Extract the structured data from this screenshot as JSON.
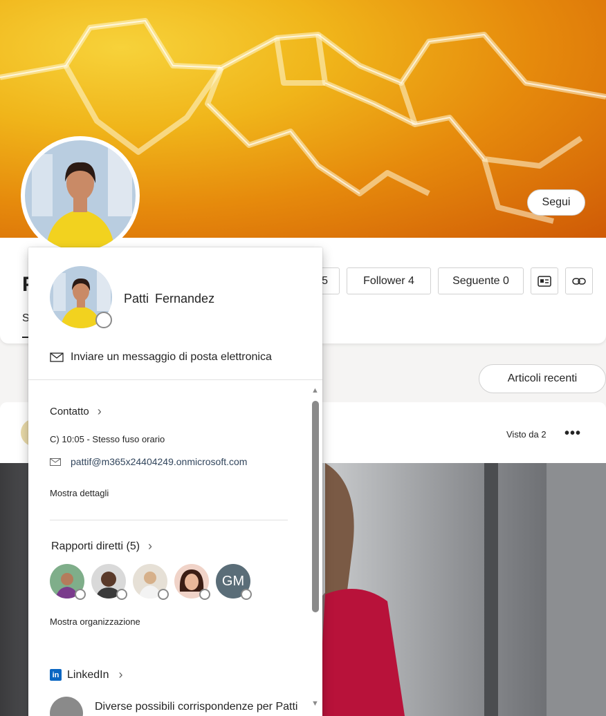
{
  "banner": {
    "follow_label": "Segui"
  },
  "header": {
    "name_initial": "P",
    "tab_initial": "S",
    "stats": {
      "partial_count": "5",
      "follower_label": "Follower 4",
      "following_label": "Seguente 0"
    },
    "icons": [
      "contact-card-icon",
      "link-icon"
    ]
  },
  "recent_button": "Articoli recenti",
  "post": {
    "seen_by": "Visto da 2",
    "more_label": "•••"
  },
  "popup": {
    "name": "Patti Fernandez",
    "email_action": "Inviare un messaggio di posta elettronica",
    "contact": {
      "title": "Contatto",
      "time_zone": "C) 10:05 - Stesso fuso orario",
      "email": "pattif@m365x24404249.onmicrosoft.com",
      "details_label": "Mostra dettagli"
    },
    "reports": {
      "title": "Rapporti diretti (5)",
      "people": [
        {
          "initials": ""
        },
        {
          "initials": ""
        },
        {
          "initials": ""
        },
        {
          "initials": ""
        },
        {
          "initials": "GM"
        }
      ],
      "org_label": "Mostra organizzazione"
    },
    "linkedin": {
      "badge": "in",
      "title": "LinkedIn",
      "matches": "Diverse possibili corrispondenze per Patti"
    }
  },
  "colors": {
    "accent_orange": "#e68a0c",
    "presence_gray": "#8a8a8a",
    "linkedin": "#0a66c2"
  }
}
